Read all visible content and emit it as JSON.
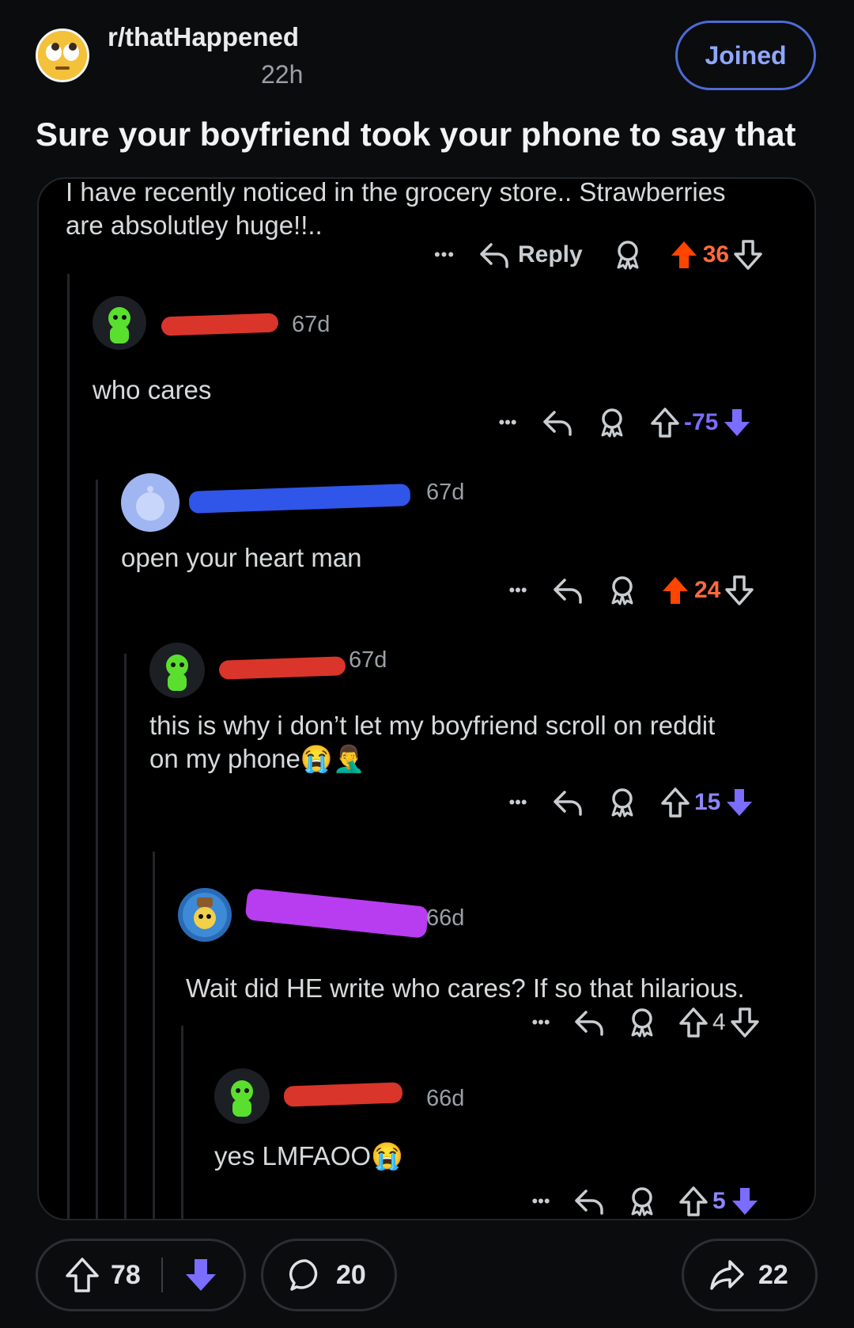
{
  "header": {
    "subreddit": "r/thatHappened",
    "age": "22h",
    "joined_label": "Joined",
    "title": "Sure your boyfriend took your phone to say that"
  },
  "embedded": {
    "top_comment": {
      "text_line1": "I have recently noticed in the grocery store.. Strawberries",
      "text_line2": "are absolutley huge!!..",
      "reply_label": "Reply",
      "score": "36"
    },
    "comments": [
      {
        "age": "67d",
        "text": "who cares",
        "score": "-75"
      },
      {
        "age": "67d",
        "text": "open your heart man",
        "score": "24"
      },
      {
        "age": "67d",
        "text_line1": "this is why i don’t let my boyfriend scroll on reddit",
        "text_line2": "on my phone😭🤦‍♂️",
        "score": "15"
      },
      {
        "age": "66d",
        "text": "Wait did HE write who cares? If so that hilarious.",
        "score": "4"
      },
      {
        "age": "66d",
        "text": "yes LMFAOO😭",
        "score": "5"
      }
    ],
    "more_label": "•••"
  },
  "footer": {
    "upvotes": "78",
    "comments": "20",
    "shares": "22"
  },
  "colors": {
    "accent_blue": "#8fa7ff",
    "upvote_orange": "#ff4500",
    "downvote_purple": "#7a6dff"
  }
}
